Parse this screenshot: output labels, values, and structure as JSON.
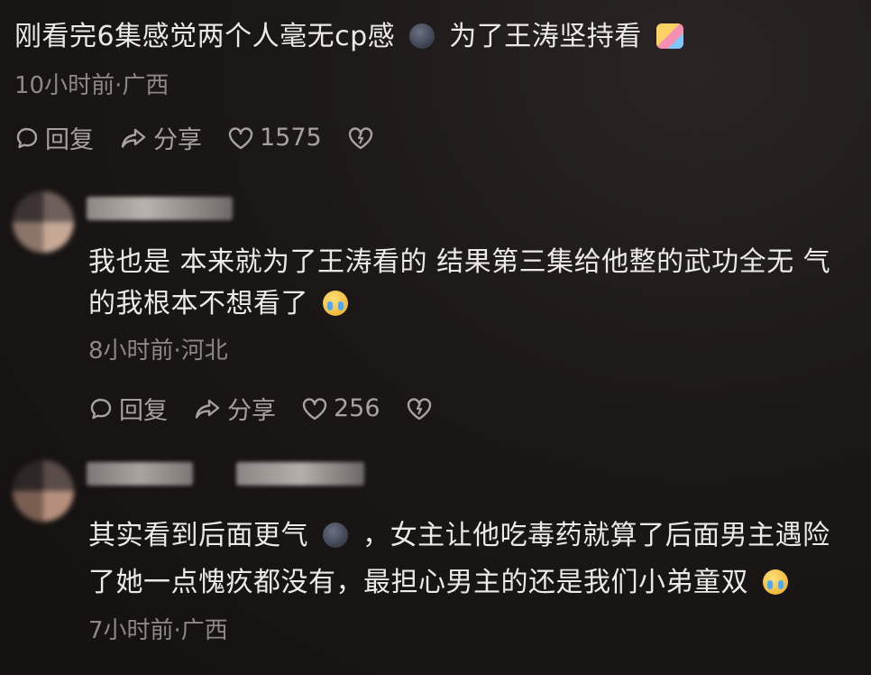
{
  "main_comment": {
    "text_a": "刚看完6集感觉两个人毫无cp感",
    "emoji_a": "dark-face-emoji",
    "text_b": "为了王涛坚持看",
    "emoji_b": "couple-emoji",
    "meta": "10小时前·广西",
    "reply_label": "回复",
    "share_label": "分享",
    "like_count": "1575"
  },
  "replies": [
    {
      "text": "我也是 本来就为了王涛看的 结果第三集给他整的武功全无 气的我根本不想看了",
      "emoji": "crying-emoji",
      "meta": "8小时前·河北",
      "reply_label": "回复",
      "share_label": "分享",
      "like_count": "256"
    },
    {
      "text_a": "其实看到后面更气",
      "emoji_a": "dark-face-emoji",
      "text_b": "，女主让他吃毒药就算了后面男主遇险了她一点愧疚都没有，最担心男主的还是我们小弟童双",
      "emoji_b": "laughing-crying-emoji",
      "meta": "7小时前·广西"
    }
  ]
}
